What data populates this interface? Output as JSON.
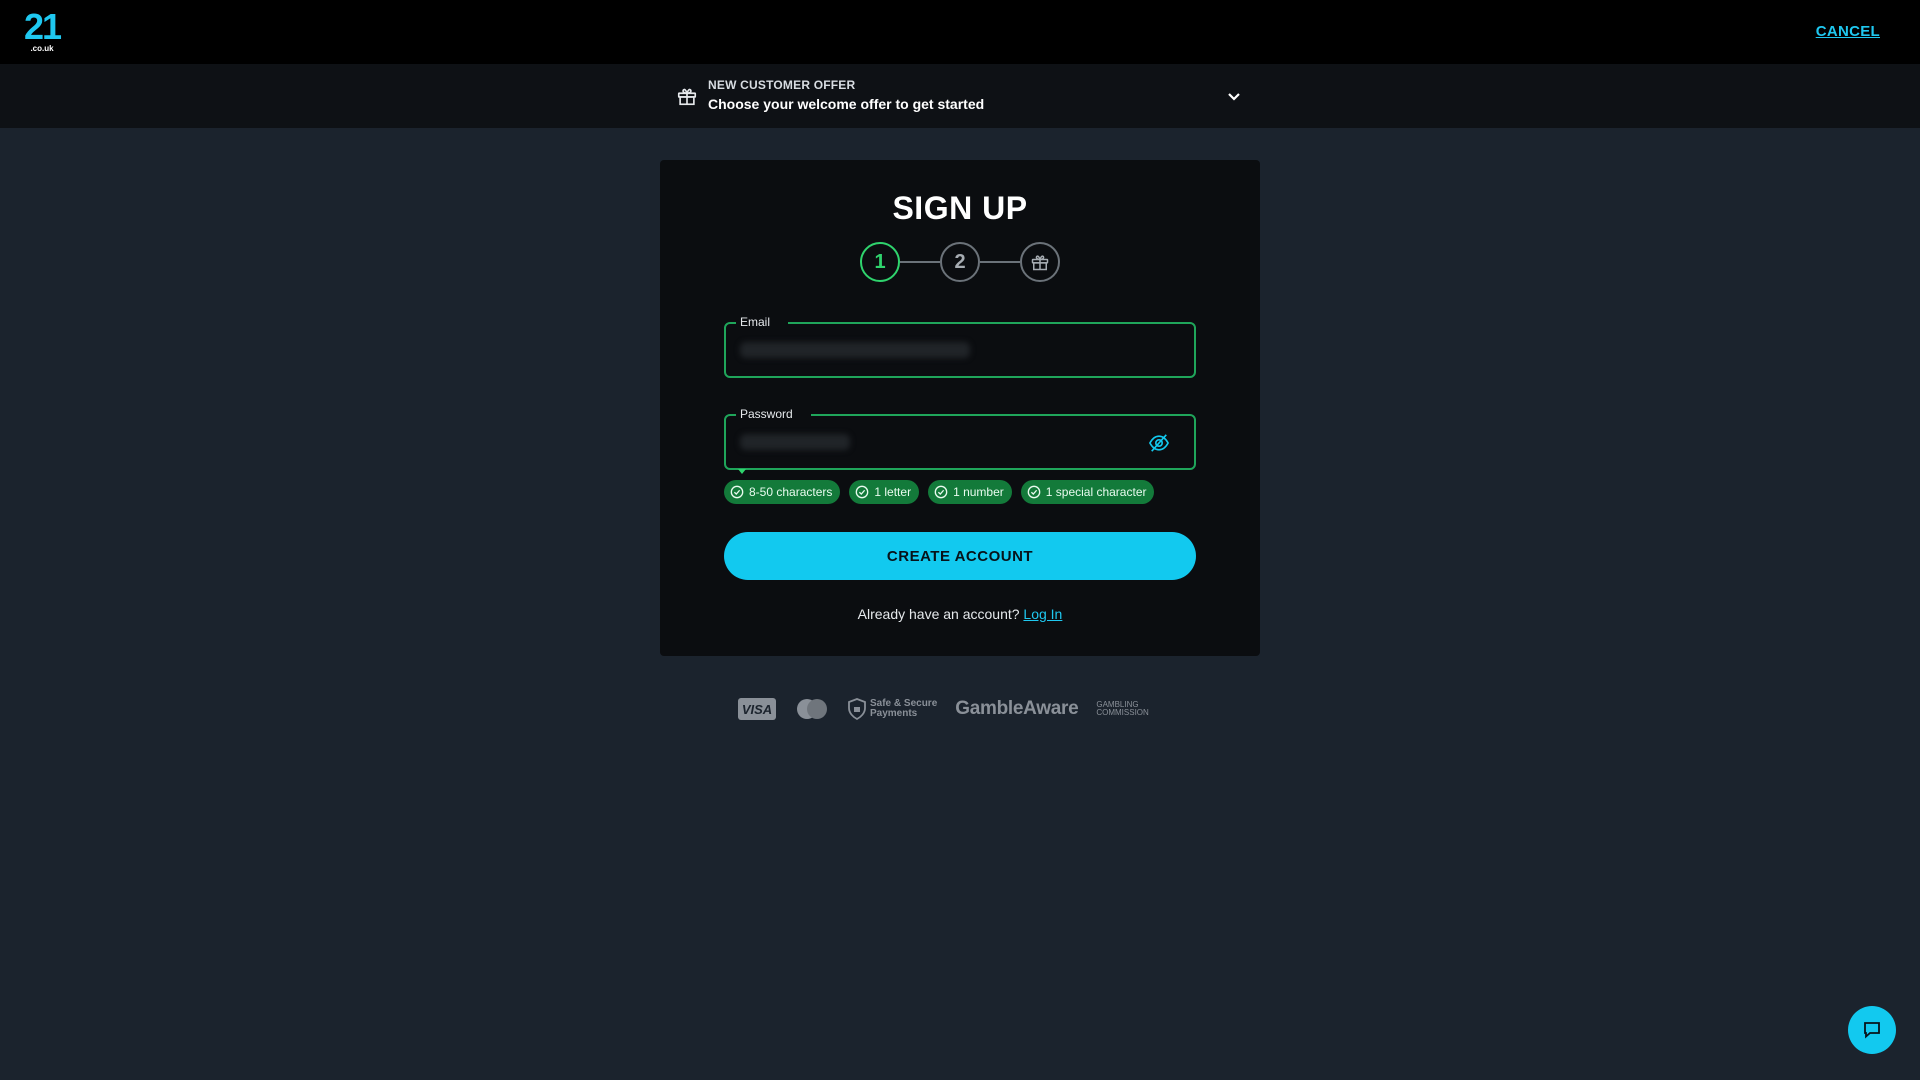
{
  "header": {
    "logo_number": "21",
    "logo_domain": ".co.uk",
    "cancel_label": "CANCEL"
  },
  "offer": {
    "tag": "NEW CUSTOMER OFFER",
    "title": "Choose your welcome offer to get started"
  },
  "signup": {
    "title": "SIGN UP",
    "steps": [
      "1",
      "2"
    ],
    "active_step": 1,
    "email_label": "Email",
    "password_label": "Password",
    "requirements": [
      "8-50 characters",
      "1 letter",
      "1 number",
      "1 special character"
    ],
    "create_button": "CREATE ACCOUNT",
    "login_prompt": "Already have an account?",
    "login_link": "Log In"
  },
  "footer": {
    "visa": "VISA",
    "safe_secure_line1": "Safe & Secure",
    "safe_secure_line2": "Payments",
    "gamble_aware": "GambleAware",
    "commission_line1": "Gambling",
    "commission_line2": "Commission"
  },
  "colors": {
    "accent": "#12c9ef",
    "success": "#2fd36d",
    "background": "#1b232d",
    "card": "#0b0d10"
  },
  "icons": {
    "offer": "gift-icon",
    "chevron": "chevron-down-icon",
    "password_toggle": "eye-slash-icon",
    "requirement": "check-circle-icon",
    "step3": "gift-icon",
    "chat": "chat-icon"
  }
}
